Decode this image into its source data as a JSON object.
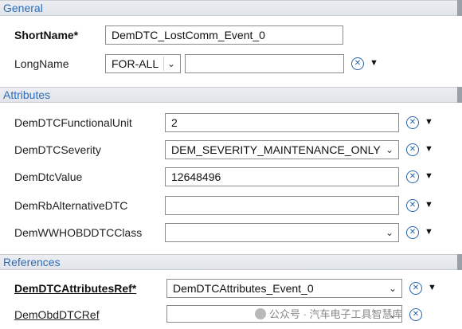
{
  "sections": {
    "general": "General",
    "attributes": "Attributes",
    "references": "References"
  },
  "general": {
    "short_name_label": "ShortName*",
    "short_name_value": "DemDTC_LostComm_Event_0",
    "long_name_label": "LongName",
    "long_name_lang": "FOR-ALL",
    "long_name_value": ""
  },
  "attributes": {
    "functional_unit_label": "DemDTCFunctionalUnit",
    "functional_unit_value": "2",
    "severity_label": "DemDTCSeverity",
    "severity_value": "DEM_SEVERITY_MAINTENANCE_ONLY",
    "dtc_value_label": "DemDtcValue",
    "dtc_value_value": "12648496",
    "rb_alt_label": "DemRbAlternativeDTC",
    "rb_alt_value": "",
    "wwhobd_label": "DemWWHOBDDTCClass",
    "wwhobd_value": ""
  },
  "references": {
    "attr_ref_label": "DemDTCAttributesRef*",
    "attr_ref_value": "DemDTCAttributes_Event_0",
    "obd_ref_label": "DemObdDTCRef",
    "obd_ref_value": ""
  },
  "icons": {
    "action_tool": "wrench-tool-icon",
    "menu_arrow": "dropdown-arrow-icon",
    "combo_arrow": "chevron-down-icon"
  },
  "watermark": "公众号 · 汽车电子工具智慧库",
  "colors": {
    "section_text": "#2e6db4",
    "section_bg": "#e4e7ec",
    "icon_blue": "#2563a8"
  }
}
